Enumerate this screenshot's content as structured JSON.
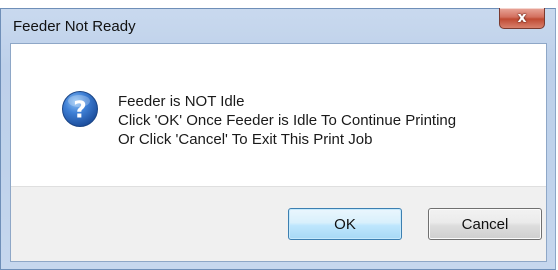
{
  "dialog": {
    "title": "Feeder Not Ready",
    "icon": "question-icon",
    "message_lines": [
      "Feeder is NOT Idle",
      "Click 'OK' Once Feeder is Idle To Continue Printing",
      "Or Click 'Cancel' To Exit This Print Job"
    ],
    "buttons": {
      "ok_label": "OK",
      "cancel_label": "Cancel"
    }
  },
  "titlebar": {
    "close_icon": "close-icon",
    "close_glyph": "x"
  },
  "colors": {
    "titlebar": "#bdd0ea",
    "close_button": "#c04a33",
    "icon_blue": "#2f64b8",
    "default_button_border": "#3c7fb1"
  }
}
